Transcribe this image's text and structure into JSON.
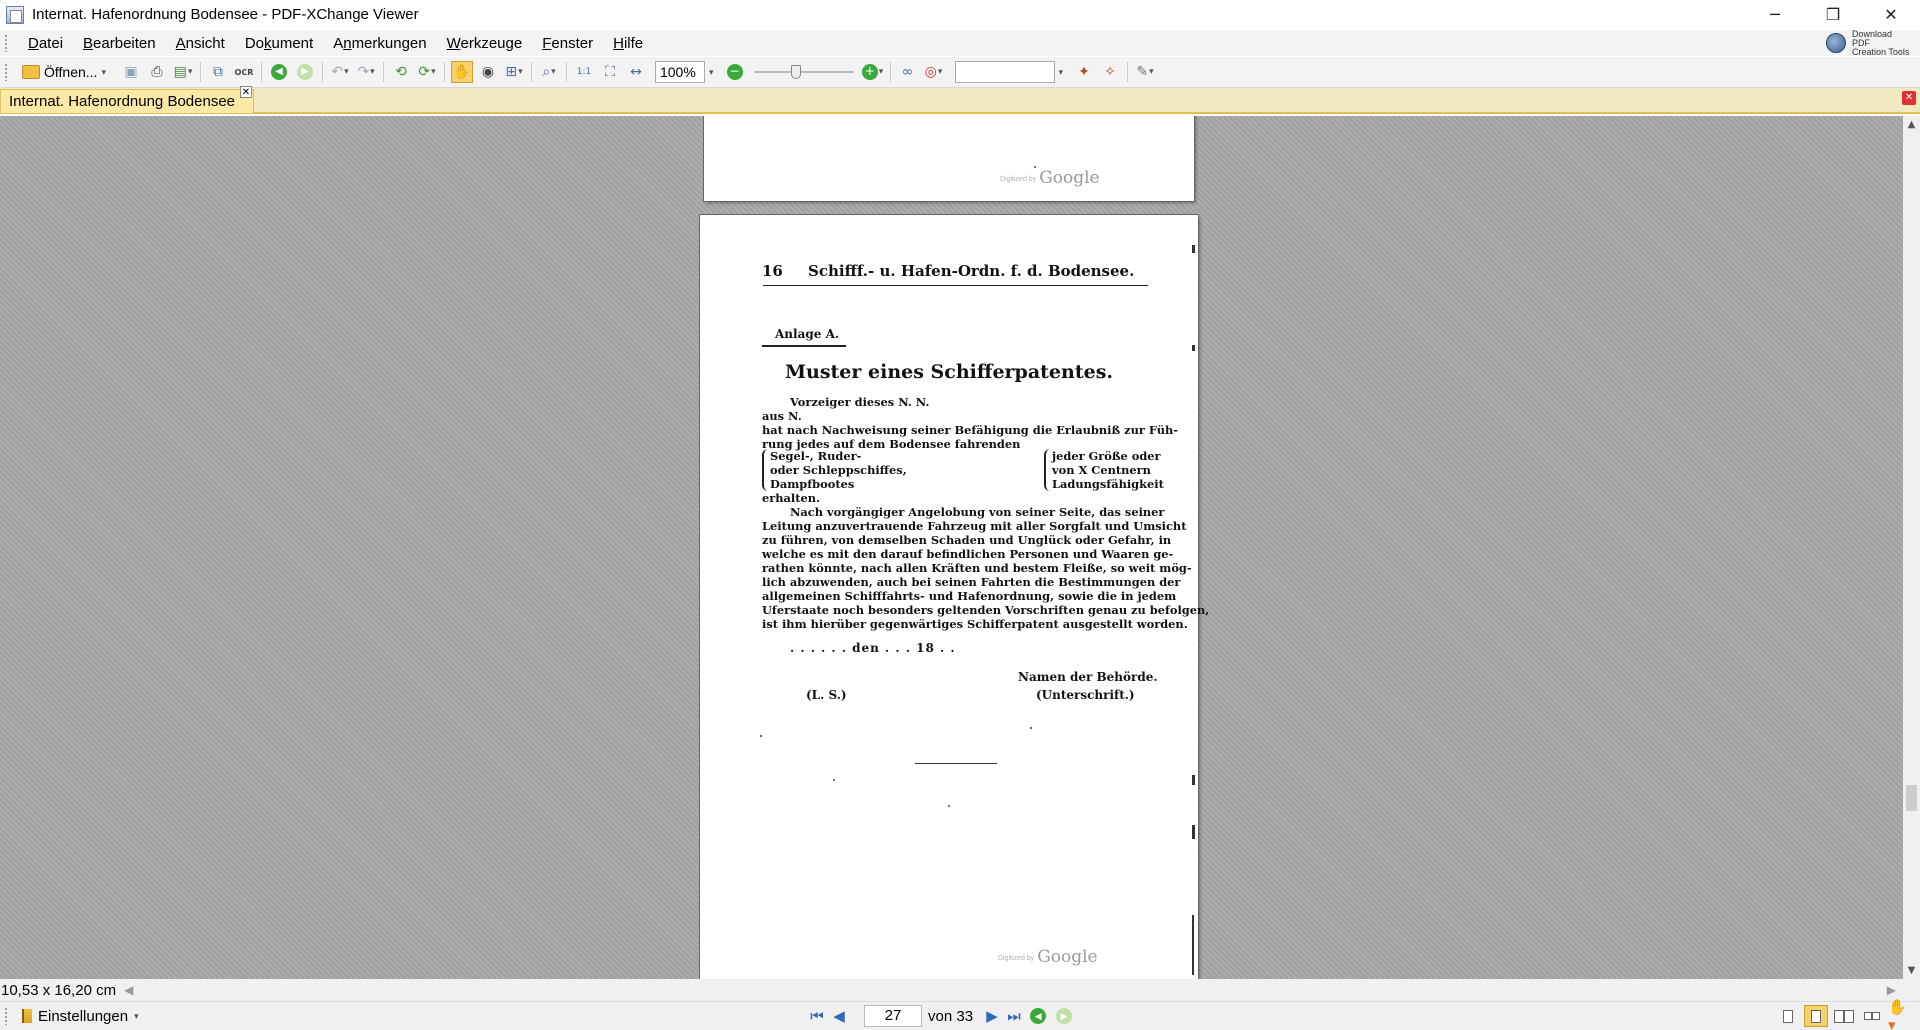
{
  "window": {
    "title": "Internat. Hafenordnung Bodensee - PDF-XChange Viewer",
    "controls": {
      "minimize": "─",
      "restore": "❐",
      "close": "✕"
    }
  },
  "menu": {
    "items": [
      {
        "pre": "",
        "u": "D",
        "post": "atei"
      },
      {
        "pre": "",
        "u": "B",
        "post": "earbeiten"
      },
      {
        "pre": "",
        "u": "A",
        "post": "nsicht"
      },
      {
        "pre": "Do",
        "u": "k",
        "post": "ument"
      },
      {
        "pre": "A",
        "u": "n",
        "post": "merkungen"
      },
      {
        "pre": "",
        "u": "W",
        "post": "erkzeuge"
      },
      {
        "pre": "",
        "u": "F",
        "post": "enster"
      },
      {
        "pre": "",
        "u": "H",
        "post": "ilfe"
      }
    ],
    "promo_line1": "Download PDF",
    "promo_line2": "Creation Tools"
  },
  "toolbar": {
    "open_label": "Öffnen...",
    "zoom_value": "100%",
    "ocr_label": "OCR",
    "search_value": ""
  },
  "tab": {
    "label": "Internat. Hafenordnung Bodensee",
    "close": "✕"
  },
  "document": {
    "watermark_small": "Digitized by",
    "watermark_big": "Google",
    "page_number": "16",
    "running_header": "Schifff.- u. Hafen-Ordn. f. d. Bodensee.",
    "appendix": "Anlage A.",
    "title": "Muster eines Schifferpatentes.",
    "intro_lines": [
      "Vorzeiger dieses N. N.",
      "aus N.",
      "hat nach Nachweisung seiner Befähigung die Erlaubniß zur Füh-",
      "rung jedes auf dem Bodensee fahrenden"
    ],
    "left_brace": [
      "Segel-, Ruder-",
      "oder Schleppschiffes,",
      "Dampfbootes"
    ],
    "right_brace": [
      "jeder Größe oder",
      "von X Centnern",
      "Ladungsfähigkeit"
    ],
    "erhalten": "erhalten.",
    "paragraph_lines": [
      "Nach vorgängiger Angelobung von seiner Seite, das seiner",
      "Leitung anzuvertrauende Fahrzeug mit aller Sorgfalt und Umsicht",
      "zu führen, von demselben Schaden und Unglück oder Gefahr, in",
      "welche es mit den darauf befindlichen Personen und Waaren ge-",
      "rathen könnte, nach allen Kräften und bestem Fleiße, so weit mög-",
      "lich abzuwenden, auch bei seinen Fahrten die Bestimmungen der",
      "allgemeinen Schifffahrts- und Hafenordnung, sowie die in jedem",
      "Uferstaate noch besonders geltenden Vorschriften genau zu befolgen,",
      "ist ihm hierüber gegenwärtiges Schifferpatent ausgestellt worden."
    ],
    "date_line": ". . . . . . den . . . 18 . .",
    "authority": "Namen der Behörde.",
    "signature": "(Unterschrift.)",
    "seal": "(L. S.)"
  },
  "status": {
    "page_size": "10,53 x 16,20 cm",
    "settings_label": "Einstellungen",
    "current_page": "27",
    "page_of": "von 33"
  },
  "colors": {
    "tab_active": "#fce9a6",
    "tab_border": "#e2c04a",
    "nav_blue": "#2e6ab8",
    "go_green": "#3aa83a"
  }
}
